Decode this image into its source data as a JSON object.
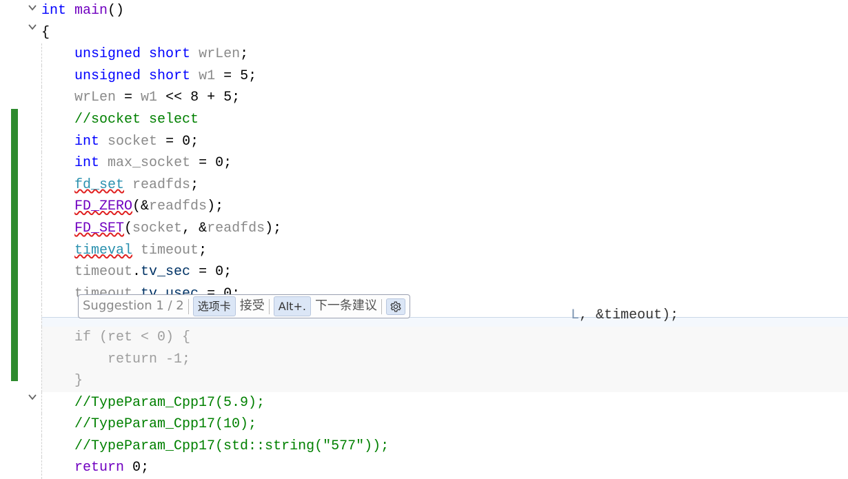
{
  "code": {
    "l0": {
      "kw1": "int",
      "fn": "main",
      "paren": "()"
    },
    "l1": {
      "brace": "{"
    },
    "l2": {
      "kw": "unsigned short",
      "id": "wrLen",
      "tail": ";"
    },
    "l3": {
      "kw": "unsigned short",
      "id": "w1",
      "op": " = ",
      "val": "5",
      "tail": ";"
    },
    "l4": {
      "id1": "wrLen",
      "op1": " = ",
      "id2": "w1",
      "op2": " << ",
      "v1": "8",
      "op3": " + ",
      "v2": "5",
      "tail": ";"
    },
    "l5": {
      "comment": "//socket select"
    },
    "l6": {
      "kw": "int",
      "id": "socket",
      "op": " = ",
      "val": "0",
      "tail": ";"
    },
    "l7": {
      "kw": "int",
      "id": "max_socket",
      "op": " = ",
      "val": "0",
      "tail": ";"
    },
    "l8": {
      "t": "fd_set",
      "id": "readfds",
      "tail": ";"
    },
    "l9": {
      "fn": "FD_ZERO",
      "open": "(&",
      "arg": "readfds",
      "close": ");"
    },
    "l10": {
      "fn": "FD_SET",
      "open": "(",
      "a1": "socket",
      "sep": ", &",
      "a2": "readfds",
      "close": ");"
    },
    "l11": {
      "t": "timeval",
      "id": "timeout",
      "tail": ";"
    },
    "l12": {
      "id": "timeout",
      "dot": ".",
      "m": "tv_sec",
      "op": " = ",
      "val": "0",
      "tail": ";"
    },
    "l13": {
      "id": "timeout",
      "dot": ".",
      "m": "tv_usec",
      "op": " = ",
      "val": "0",
      "tail": ";"
    },
    "l14_tail": {
      "text": ", &timeout);"
    },
    "l15": {
      "text": "if (ret < 0) {"
    },
    "l16": {
      "text": "    return -1;"
    },
    "l17": {
      "text": "}"
    },
    "l18": {
      "comment": "//TypeParam_Cpp17(5.9);"
    },
    "l19": {
      "comment": "//TypeParam_Cpp17(10);"
    },
    "l20": {
      "comment": "//TypeParam_Cpp17(std::string(\"577\"));"
    },
    "l21": {
      "kw": "return",
      "val": "0",
      "tail": ";"
    }
  },
  "suggestion": {
    "title": "Suggestion 1 / 2",
    "tab_kbd": "选项卡",
    "accept": "接受",
    "alt_kbd": "Alt+.",
    "next": "下一条建议"
  },
  "icons": {
    "gear": "gear-icon",
    "cd": "chevron-down-icon"
  }
}
